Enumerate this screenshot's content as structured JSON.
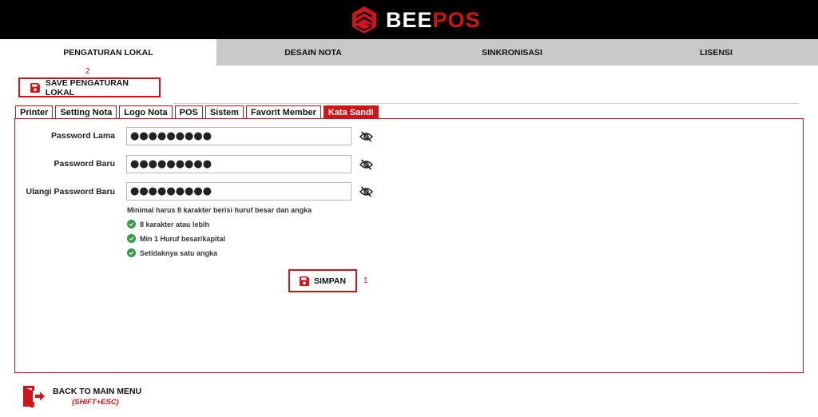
{
  "app": {
    "brand_part1": "BEE",
    "brand_part2": "POS"
  },
  "main_tabs": [
    {
      "label": "PENGATURAN LOKAL",
      "active": true
    },
    {
      "label": "DESAIN NOTA",
      "active": false
    },
    {
      "label": "SINKRONISASI",
      "active": false
    },
    {
      "label": "LISENSI",
      "active": false
    }
  ],
  "save_lokal": {
    "label": "SAVE PENGATURAN LOKAL",
    "annotation": "2"
  },
  "sub_tabs": [
    {
      "label": "Printer",
      "active": false
    },
    {
      "label": "Setting Nota",
      "active": false
    },
    {
      "label": "Logo Nota",
      "active": false
    },
    {
      "label": "POS",
      "active": false
    },
    {
      "label": "Sistem",
      "active": false
    },
    {
      "label": "Favorit Member",
      "active": false
    },
    {
      "label": "Kata Sandi",
      "active": true
    }
  ],
  "form": {
    "old_password": {
      "label": "Password Lama",
      "value": "●●●●●●●●●"
    },
    "new_password": {
      "label": "Password Baru",
      "value": "●●●●●●●●●"
    },
    "repeat_password": {
      "label": "Ulangi Password Baru",
      "value": "●●●●●●●●●"
    },
    "hint": "Minimal harus 8 karakter berisi huruf besar dan angka",
    "rules": [
      "8 karakter atau lebih",
      "Min 1 Huruf besar/kapital",
      "Setidaknya satu angka"
    ]
  },
  "simpan": {
    "label": "SIMPAN",
    "annotation": "1"
  },
  "back": {
    "label": "BACK TO MAIN MENU",
    "shortcut": "(SHIFT+ESC)"
  },
  "icons": {
    "logo": "beepos-hex-logo-icon",
    "save": "floppy-disk-icon",
    "eye": "eye-off-icon",
    "check": "check-circle-icon",
    "back": "exit-door-icon"
  },
  "colors": {
    "accent": "#d0151a",
    "header_bg": "#000000",
    "tabbar_bg": "#c8c8c8",
    "success": "#2e9e3e"
  }
}
